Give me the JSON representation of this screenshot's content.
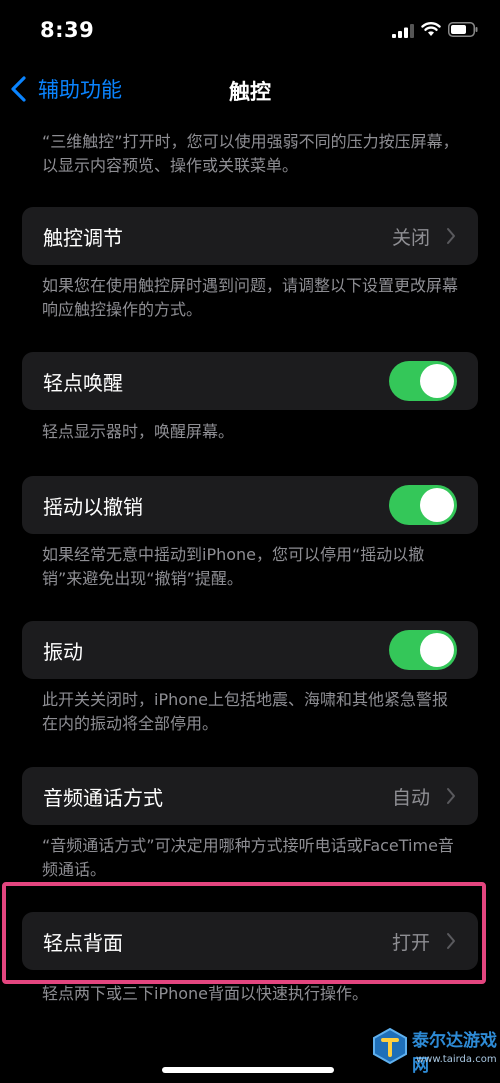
{
  "status_bar": {
    "time": "8:39"
  },
  "nav": {
    "back_label": "辅助功能",
    "title": "触控"
  },
  "sections": {
    "intro_footer": "“三维触控”打开时，您可以使用强弱不同的压力按压屏幕，以显示内容预览、操作或关联菜单。",
    "touch_accommodations": {
      "label": "触控调节",
      "value": "关闭",
      "footer": "如果您在使用触控屏时遇到问题，请调整以下设置更改屏幕响应触控操作的方式。"
    },
    "tap_to_wake": {
      "label": "轻点唤醒",
      "on": true,
      "footer": "轻点显示器时，唤醒屏幕。"
    },
    "shake_to_undo": {
      "label": "摇动以撤销",
      "on": true,
      "footer": "如果经常无意中摇动到iPhone，您可以停用“摇动以撤销”来避免出现“撤销”提醒。"
    },
    "vibration": {
      "label": "振动",
      "on": true,
      "footer": "此开关关闭时，iPhone上包括地震、海啸和其他紧急警报在内的振动将全部停用。"
    },
    "call_audio_routing": {
      "label": "音频通话方式",
      "value": "自动",
      "footer": "“音频通话方式”可决定用哪种方式接听电话或FaceTime音频通话。"
    },
    "back_tap": {
      "label": "轻点背面",
      "value": "打开",
      "footer": "轻点两下或三下iPhone背面以快速执行操作。"
    }
  },
  "colors": {
    "accent": "#0a84ff",
    "toggle_on": "#34c759",
    "cell_bg": "#1c1c1e",
    "highlight": "#e3457f"
  },
  "watermark": {
    "title": "泰尔达游戏网",
    "url": "www.tairda.com"
  }
}
